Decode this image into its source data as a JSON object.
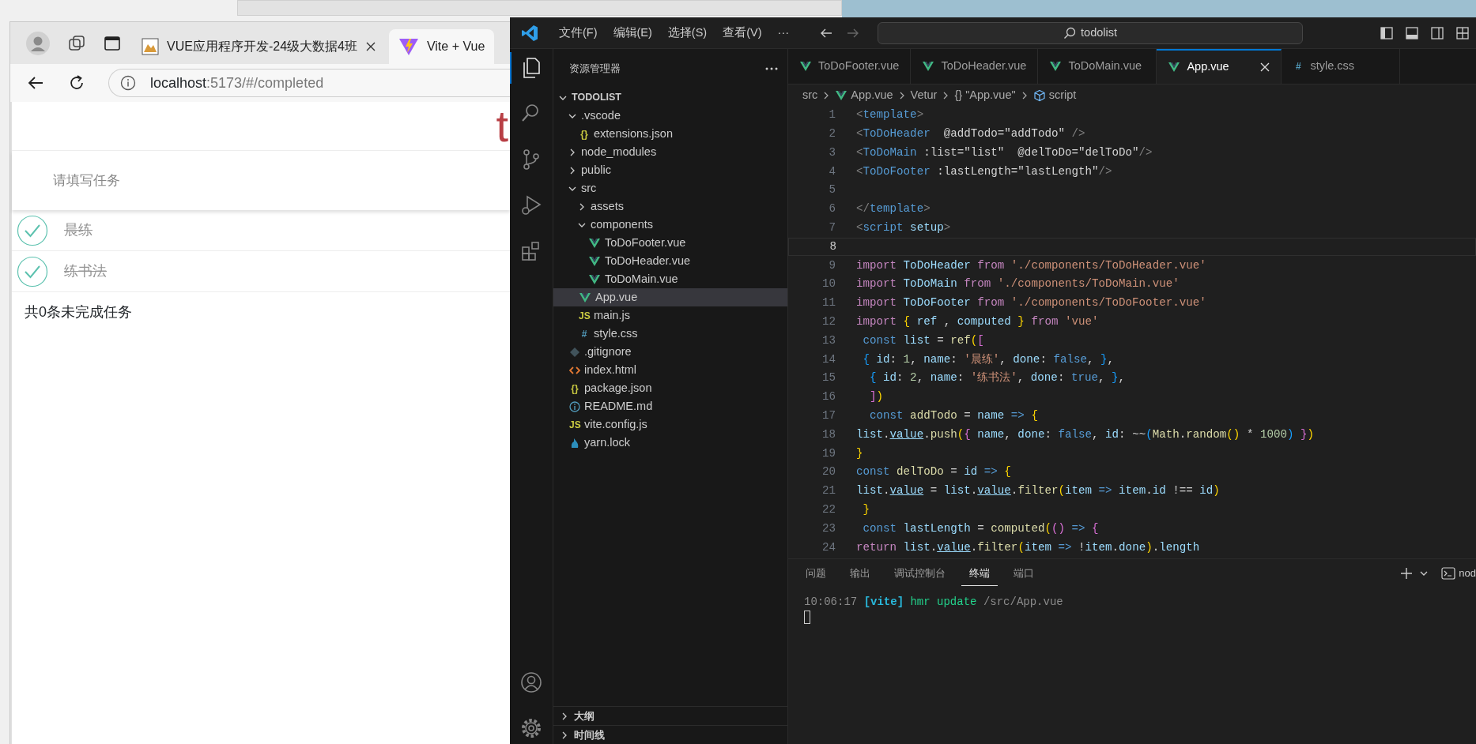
{
  "browser": {
    "tabs": [
      {
        "title": "VUE应用程序开发-24级大数据4班",
        "kind": "image",
        "selected": false
      },
      {
        "title": "Vite + Vue",
        "kind": "vite",
        "selected": true
      }
    ],
    "address": {
      "host": "localhost",
      "path": ":5173/#/completed"
    },
    "page": {
      "title": "t",
      "input": {
        "placeholder": "请填写任务"
      },
      "todos": [
        {
          "name": "晨练",
          "done": true
        },
        {
          "name": "练书法",
          "done": true
        }
      ],
      "footer": "共0条未完成任务"
    }
  },
  "editor_window": {
    "menu": [
      "文件(F)",
      "编辑(E)",
      "选择(S)",
      "查看(V)",
      "···"
    ],
    "search": "todolist",
    "activity_bar": [
      {
        "kind": "explorer",
        "selected": true
      },
      {
        "kind": "search",
        "selected": false
      },
      {
        "kind": "source-control",
        "selected": false
      },
      {
        "kind": "run-debug",
        "selected": false
      },
      {
        "kind": "extensions",
        "selected": false
      },
      {
        "kind": "account",
        "selected": false
      },
      {
        "kind": "settings",
        "selected": false
      }
    ],
    "sidebar": {
      "title": "资源管理器",
      "tree": [
        {
          "label": "TODOLIST",
          "kind": "root",
          "expanded": true,
          "selected": false,
          "children": [
            {
              "label": ".vscode",
              "kind": "folder",
              "expanded": true,
              "selected": false,
              "children": [
                {
                  "label": "extensions.json",
                  "kind": "json",
                  "icon": "{}",
                  "selected": false
                }
              ]
            },
            {
              "label": "node_modules",
              "kind": "folder",
              "expanded": false,
              "selected": false
            },
            {
              "label": "public",
              "kind": "folder",
              "expanded": false,
              "selected": false
            },
            {
              "label": "src",
              "kind": "folder",
              "expanded": true,
              "selected": false,
              "children": [
                {
                  "label": "assets",
                  "kind": "folder",
                  "expanded": false,
                  "selected": false
                },
                {
                  "label": "components",
                  "kind": "folder",
                  "expanded": true,
                  "selected": false,
                  "children": [
                    {
                      "label": "ToDoFooter.vue",
                      "kind": "vue",
                      "selected": false
                    },
                    {
                      "label": "ToDoHeader.vue",
                      "kind": "vue",
                      "selected": false
                    },
                    {
                      "label": "ToDoMain.vue",
                      "kind": "vue",
                      "selected": false
                    }
                  ]
                },
                {
                  "label": "App.vue",
                  "kind": "vue",
                  "selected": true
                },
                {
                  "label": "main.js",
                  "kind": "js",
                  "icon": "JS",
                  "selected": false
                },
                {
                  "label": "style.css",
                  "kind": "css",
                  "icon": "#",
                  "selected": false
                }
              ]
            },
            {
              "label": ".gitignore",
              "kind": "git",
              "selected": false
            },
            {
              "label": "index.html",
              "kind": "html",
              "selected": false
            },
            {
              "label": "package.json",
              "kind": "json",
              "icon": "{}",
              "selected": false
            },
            {
              "label": "README.md",
              "kind": "info",
              "selected": false
            },
            {
              "label": "vite.config.js",
              "kind": "js",
              "icon": "JS",
              "selected": false
            },
            {
              "label": "yarn.lock",
              "kind": "yarn",
              "selected": false
            }
          ]
        }
      ],
      "sections": [
        {
          "label": "大纲",
          "expanded": false
        },
        {
          "label": "时间线",
          "expanded": false
        }
      ]
    },
    "tabs": [
      {
        "label": "ToDoFooter.vue",
        "kind": "vue",
        "selected": false
      },
      {
        "label": "ToDoHeader.vue",
        "kind": "vue",
        "selected": false
      },
      {
        "label": "ToDoMain.vue",
        "kind": "vue",
        "selected": false
      },
      {
        "label": "App.vue",
        "kind": "vue",
        "selected": true
      },
      {
        "label": "style.css",
        "kind": "css",
        "icon": "#",
        "selected": false
      }
    ],
    "breadcrumb": [
      {
        "text": "src",
        "kind": "text"
      },
      {
        "text": "App.vue",
        "kind": "vue"
      },
      {
        "text": "Vetur",
        "kind": "text"
      },
      {
        "text": "\"App.vue\"",
        "kind": "braces",
        "icon": "{}"
      },
      {
        "text": "script",
        "kind": "cube"
      }
    ],
    "code": [
      {
        "number": "1",
        "current": false,
        "tokens": [
          {
            "kind": "punct",
            "text": "<"
          },
          {
            "kind": "tag",
            "text": "template"
          },
          {
            "kind": "punct",
            "text": ">"
          }
        ]
      },
      {
        "number": "2",
        "current": false,
        "tokens": [
          {
            "kind": "punct",
            "text": "<"
          },
          {
            "kind": "tag",
            "text": "ToDoHeader"
          },
          {
            "kind": "plain",
            "text": "  @addTodo=\"addTodo\" "
          },
          {
            "kind": "punct",
            "text": "/>"
          }
        ]
      },
      {
        "number": "3",
        "current": false,
        "tokens": [
          {
            "kind": "punct",
            "text": "<"
          },
          {
            "kind": "tag",
            "text": "ToDoMain"
          },
          {
            "kind": "plain",
            "text": " :list=\"list\"  @delToDo=\"delToDo\""
          },
          {
            "kind": "punct",
            "text": "/>"
          }
        ]
      },
      {
        "number": "4",
        "current": false,
        "tokens": [
          {
            "kind": "punct",
            "text": "<"
          },
          {
            "kind": "tag",
            "text": "ToDoFooter"
          },
          {
            "kind": "plain",
            "text": " :lastLength=\"lastLength\""
          },
          {
            "kind": "punct",
            "text": "/>"
          }
        ]
      },
      {
        "number": "5",
        "current": false
      },
      {
        "number": "6",
        "current": false,
        "tokens": [
          {
            "kind": "punct",
            "text": "</"
          },
          {
            "kind": "tag",
            "text": "template"
          },
          {
            "kind": "punct",
            "text": ">"
          }
        ]
      },
      {
        "number": "7",
        "current": false,
        "tokens": [
          {
            "kind": "punct",
            "text": "<"
          },
          {
            "kind": "tag",
            "text": "script"
          },
          {
            "kind": "var",
            "text": " setup"
          },
          {
            "kind": "punct",
            "text": ">"
          }
        ]
      },
      {
        "number": "8",
        "current": true
      },
      {
        "number": "9",
        "current": false,
        "tokens": [
          {
            "kind": "kw",
            "text": "import"
          },
          {
            "kind": "var",
            "text": " ToDoHeader "
          },
          {
            "kind": "kw",
            "text": "from"
          },
          {
            "kind": "str",
            "text": " './components/ToDoHeader.vue'"
          }
        ]
      },
      {
        "number": "10",
        "current": false,
        "tokens": [
          {
            "kind": "kw",
            "text": "import"
          },
          {
            "kind": "var",
            "text": " ToDoMain "
          },
          {
            "kind": "kw",
            "text": "from"
          },
          {
            "kind": "str",
            "text": " './components/ToDoMain.vue'"
          }
        ]
      },
      {
        "number": "11",
        "current": false,
        "tokens": [
          {
            "kind": "kw",
            "text": "import"
          },
          {
            "kind": "var",
            "text": " ToDoFooter "
          },
          {
            "kind": "kw",
            "text": "from"
          },
          {
            "kind": "str",
            "text": " './components/ToDoFooter.vue'"
          }
        ]
      },
      {
        "number": "12",
        "current": false,
        "tokens": [
          {
            "kind": "kw",
            "text": "import"
          },
          {
            "kind": "b1",
            "text": " {"
          },
          {
            "kind": "var",
            "text": " ref"
          },
          {
            "kind": "plain",
            "text": " ,"
          },
          {
            "kind": "var",
            "text": " computed"
          },
          {
            "kind": "b1",
            "text": " }"
          },
          {
            "kind": "kw",
            "text": " from"
          },
          {
            "kind": "str",
            "text": " 'vue'"
          }
        ]
      },
      {
        "number": "13",
        "current": false,
        "tokens": [
          {
            "kind": "kwb",
            "text": " const"
          },
          {
            "kind": "var",
            "text": " list"
          },
          {
            "kind": "plain",
            "text": " ="
          },
          {
            "kind": "func",
            "text": " ref"
          },
          {
            "kind": "b1",
            "text": "("
          },
          {
            "kind": "b2",
            "text": "["
          }
        ]
      },
      {
        "number": "14",
        "current": false,
        "tokens": [
          {
            "kind": "b3",
            "text": " {"
          },
          {
            "kind": "var",
            "text": " id"
          },
          {
            "kind": "plain",
            "text": ":"
          },
          {
            "kind": "num",
            "text": " 1"
          },
          {
            "kind": "plain",
            "text": ","
          },
          {
            "kind": "var",
            "text": " name"
          },
          {
            "kind": "plain",
            "text": ":"
          },
          {
            "kind": "str",
            "text": " '晨练'"
          },
          {
            "kind": "plain",
            "text": ","
          },
          {
            "kind": "var",
            "text": " done"
          },
          {
            "kind": "plain",
            "text": ":"
          },
          {
            "kind": "bool",
            "text": " false"
          },
          {
            "kind": "plain",
            "text": ","
          },
          {
            "kind": "b3",
            "text": " }"
          },
          {
            "kind": "plain",
            "text": ","
          }
        ]
      },
      {
        "number": "15",
        "current": false,
        "tokens": [
          {
            "kind": "b3",
            "text": "  {"
          },
          {
            "kind": "var",
            "text": " id"
          },
          {
            "kind": "plain",
            "text": ":"
          },
          {
            "kind": "num",
            "text": " 2"
          },
          {
            "kind": "plain",
            "text": ","
          },
          {
            "kind": "var",
            "text": " name"
          },
          {
            "kind": "plain",
            "text": ":"
          },
          {
            "kind": "str",
            "text": " '练书法'"
          },
          {
            "kind": "plain",
            "text": ","
          },
          {
            "kind": "var",
            "text": " done"
          },
          {
            "kind": "plain",
            "text": ":"
          },
          {
            "kind": "bool",
            "text": " true"
          },
          {
            "kind": "plain",
            "text": ","
          },
          {
            "kind": "b3",
            "text": " }"
          },
          {
            "kind": "plain",
            "text": ","
          }
        ]
      },
      {
        "number": "16",
        "current": false,
        "tokens": [
          {
            "kind": "b2",
            "text": "  ]"
          },
          {
            "kind": "b1",
            "text": ")"
          }
        ]
      },
      {
        "number": "17",
        "current": false,
        "tokens": [
          {
            "kind": "kwb",
            "text": "  const"
          },
          {
            "kind": "func",
            "text": " addTodo"
          },
          {
            "kind": "plain",
            "text": " ="
          },
          {
            "kind": "var",
            "text": " name"
          },
          {
            "kind": "kwb",
            "text": " =>"
          },
          {
            "kind": "b1",
            "text": " {"
          }
        ]
      },
      {
        "number": "18",
        "current": false,
        "tokens": [
          {
            "kind": "var",
            "text": "list"
          },
          {
            "kind": "plain",
            "text": "."
          },
          {
            "kind": "varu",
            "text": "value"
          },
          {
            "kind": "plain",
            "text": "."
          },
          {
            "kind": "func",
            "text": "push"
          },
          {
            "kind": "b1",
            "text": "("
          },
          {
            "kind": "b2",
            "text": "{"
          },
          {
            "kind": "var",
            "text": " name"
          },
          {
            "kind": "plain",
            "text": ","
          },
          {
            "kind": "var",
            "text": " done"
          },
          {
            "kind": "plain",
            "text": ":"
          },
          {
            "kind": "bool",
            "text": " false"
          },
          {
            "kind": "plain",
            "text": ","
          },
          {
            "kind": "var",
            "text": " id"
          },
          {
            "kind": "plain",
            "text": ": ~~"
          },
          {
            "kind": "b3",
            "text": "("
          },
          {
            "kind": "func",
            "text": "Math"
          },
          {
            "kind": "plain",
            "text": "."
          },
          {
            "kind": "func",
            "text": "random"
          },
          {
            "kind": "b1",
            "text": "()"
          },
          {
            "kind": "plain",
            "text": " * "
          },
          {
            "kind": "num",
            "text": "1000"
          },
          {
            "kind": "b3",
            "text": ")"
          },
          {
            "kind": "b2",
            "text": " }"
          },
          {
            "kind": "b1",
            "text": ")"
          }
        ]
      },
      {
        "number": "19",
        "current": false,
        "tokens": [
          {
            "kind": "b1",
            "text": "}"
          }
        ]
      },
      {
        "number": "20",
        "current": false,
        "tokens": [
          {
            "kind": "kwb",
            "text": "const"
          },
          {
            "kind": "func",
            "text": " delToDo"
          },
          {
            "kind": "plain",
            "text": " ="
          },
          {
            "kind": "var",
            "text": " id"
          },
          {
            "kind": "kwb",
            "text": " =>"
          },
          {
            "kind": "b1",
            "text": " {"
          }
        ]
      },
      {
        "number": "21",
        "current": false,
        "tokens": [
          {
            "kind": "var",
            "text": "list"
          },
          {
            "kind": "plain",
            "text": "."
          },
          {
            "kind": "varu",
            "text": "value"
          },
          {
            "kind": "plain",
            "text": " = "
          },
          {
            "kind": "var",
            "text": "list"
          },
          {
            "kind": "plain",
            "text": "."
          },
          {
            "kind": "varu",
            "text": "value"
          },
          {
            "kind": "plain",
            "text": "."
          },
          {
            "kind": "func",
            "text": "filter"
          },
          {
            "kind": "b1",
            "text": "("
          },
          {
            "kind": "var",
            "text": "item"
          },
          {
            "kind": "kwb",
            "text": " =>"
          },
          {
            "kind": "var",
            "text": " item"
          },
          {
            "kind": "plain",
            "text": "."
          },
          {
            "kind": "var",
            "text": "id"
          },
          {
            "kind": "plain",
            "text": " !== "
          },
          {
            "kind": "var",
            "text": "id"
          },
          {
            "kind": "b1",
            "text": ")"
          }
        ]
      },
      {
        "number": "22",
        "current": false,
        "tokens": [
          {
            "kind": "b1",
            "text": " }"
          }
        ]
      },
      {
        "number": "23",
        "current": false,
        "tokens": [
          {
            "kind": "kwb",
            "text": " const"
          },
          {
            "kind": "var",
            "text": " lastLength"
          },
          {
            "kind": "plain",
            "text": " ="
          },
          {
            "kind": "func",
            "text": " computed"
          },
          {
            "kind": "b1",
            "text": "("
          },
          {
            "kind": "b2",
            "text": "()"
          },
          {
            "kind": "kwb",
            "text": " =>"
          },
          {
            "kind": "b2",
            "text": " {"
          }
        ]
      },
      {
        "number": "24",
        "current": false,
        "tokens": [
          {
            "kind": "kw",
            "text": "return"
          },
          {
            "kind": "var",
            "text": " list"
          },
          {
            "kind": "plain",
            "text": "."
          },
          {
            "kind": "varu",
            "text": "value"
          },
          {
            "kind": "plain",
            "text": "."
          },
          {
            "kind": "func",
            "text": "filter"
          },
          {
            "kind": "b1",
            "text": "("
          },
          {
            "kind": "var",
            "text": "item"
          },
          {
            "kind": "kwb",
            "text": " =>"
          },
          {
            "kind": "plain",
            "text": " !"
          },
          {
            "kind": "var",
            "text": "item"
          },
          {
            "kind": "plain",
            "text": "."
          },
          {
            "kind": "var",
            "text": "done"
          },
          {
            "kind": "b1",
            "text": ")"
          },
          {
            "kind": "plain",
            "text": "."
          },
          {
            "kind": "var",
            "text": "length"
          }
        ]
      }
    ],
    "panel": {
      "tabs": [
        {
          "label": "问题",
          "selected": false
        },
        {
          "label": "输出",
          "selected": false
        },
        {
          "label": "调试控制台",
          "selected": false
        },
        {
          "label": "终端",
          "selected": true
        },
        {
          "label": "端口",
          "selected": false
        }
      ],
      "terminal_name": "nod",
      "terminal": [
        {
          "kind": "time",
          "text": "10:06:17"
        },
        {
          "kind": "tag",
          "text": "[vite]"
        },
        {
          "kind": "msg",
          "text": "hmr update"
        },
        {
          "kind": "path",
          "text": "/src/App.vue"
        }
      ]
    }
  }
}
